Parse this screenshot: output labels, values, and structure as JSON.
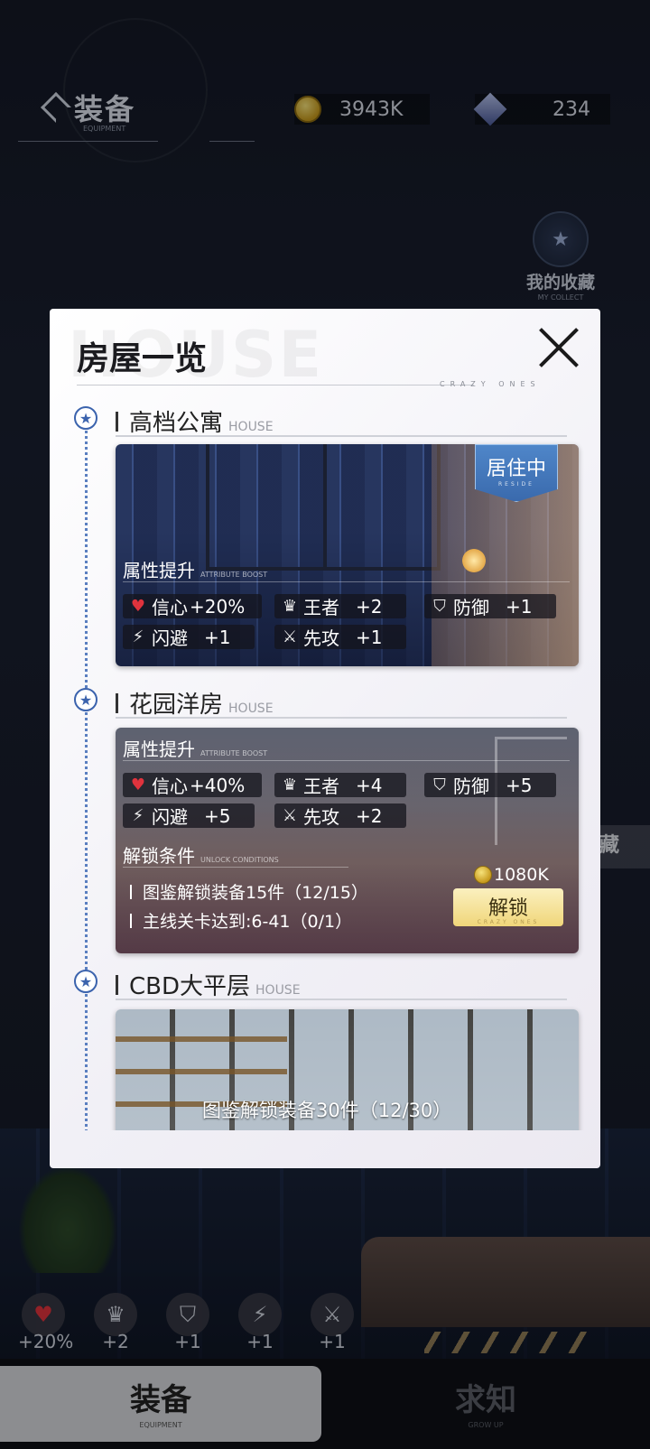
{
  "header": {
    "title": "装备",
    "subtitle": "EQUIPMENT",
    "coins": "3943K",
    "gems": "234"
  },
  "collection": {
    "label": "我的收藏",
    "sub": "MY COLLECT"
  },
  "side_tag": {
    "label": "藏"
  },
  "modal": {
    "title": "房屋一览",
    "watermark": "HOUSE",
    "brand": "CRAZY ONES",
    "close_icon": "close-icon",
    "houses": [
      {
        "name": "高档公寓",
        "tag": "HOUSE",
        "status": "居住中",
        "status_sub": "RESIDE",
        "attr_title": "属性提升",
        "attr_sub": "ATTRIBUTE BOOST",
        "stats": [
          {
            "icon": "heart-icon",
            "name": "信心",
            "value": "+20%"
          },
          {
            "icon": "crown-icon",
            "name": "王者",
            "value": "+2"
          },
          {
            "icon": "shield-icon",
            "name": "防御",
            "value": "+1"
          },
          {
            "icon": "lightning-icon",
            "name": "闪避",
            "value": "+1"
          },
          {
            "icon": "swords-icon",
            "name": "先攻",
            "value": "+1"
          }
        ]
      },
      {
        "name": "花园洋房",
        "tag": "HOUSE",
        "attr_title": "属性提升",
        "attr_sub": "ATTRIBUTE BOOST",
        "stats": [
          {
            "icon": "heart-icon",
            "name": "信心",
            "value": "+40%"
          },
          {
            "icon": "crown-icon",
            "name": "王者",
            "value": "+4"
          },
          {
            "icon": "shield-icon",
            "name": "防御",
            "value": "+5"
          },
          {
            "icon": "lightning-icon",
            "name": "闪避",
            "value": "+5"
          },
          {
            "icon": "swords-icon",
            "name": "先攻",
            "value": "+2"
          }
        ],
        "unlock_title": "解锁条件",
        "unlock_sub": "UNLOCK CONDITIONS",
        "conditions": [
          "图鉴解锁装备15件（12/15）",
          "主线关卡达到:6-41（0/1）"
        ],
        "price": "1080K",
        "unlock_label": "解锁",
        "unlock_sub_label": "CRAZY ONES"
      },
      {
        "name": "CBD大平层",
        "tag": "HOUSE",
        "condition_preview": "图鉴解锁装备30件（12/30）"
      }
    ]
  },
  "bottom_stats": [
    {
      "icon": "heart-icon",
      "value": "+20%"
    },
    {
      "icon": "crown-icon",
      "value": "+2"
    },
    {
      "icon": "shield-icon",
      "value": "+1"
    },
    {
      "icon": "lightning-icon",
      "value": "+1"
    },
    {
      "icon": "swords-icon",
      "value": "+1"
    }
  ],
  "tabs": [
    {
      "label": "装备",
      "sub": "EQUIPMENT",
      "active": true
    },
    {
      "label": "求知",
      "sub": "GROW UP",
      "active": false
    }
  ]
}
